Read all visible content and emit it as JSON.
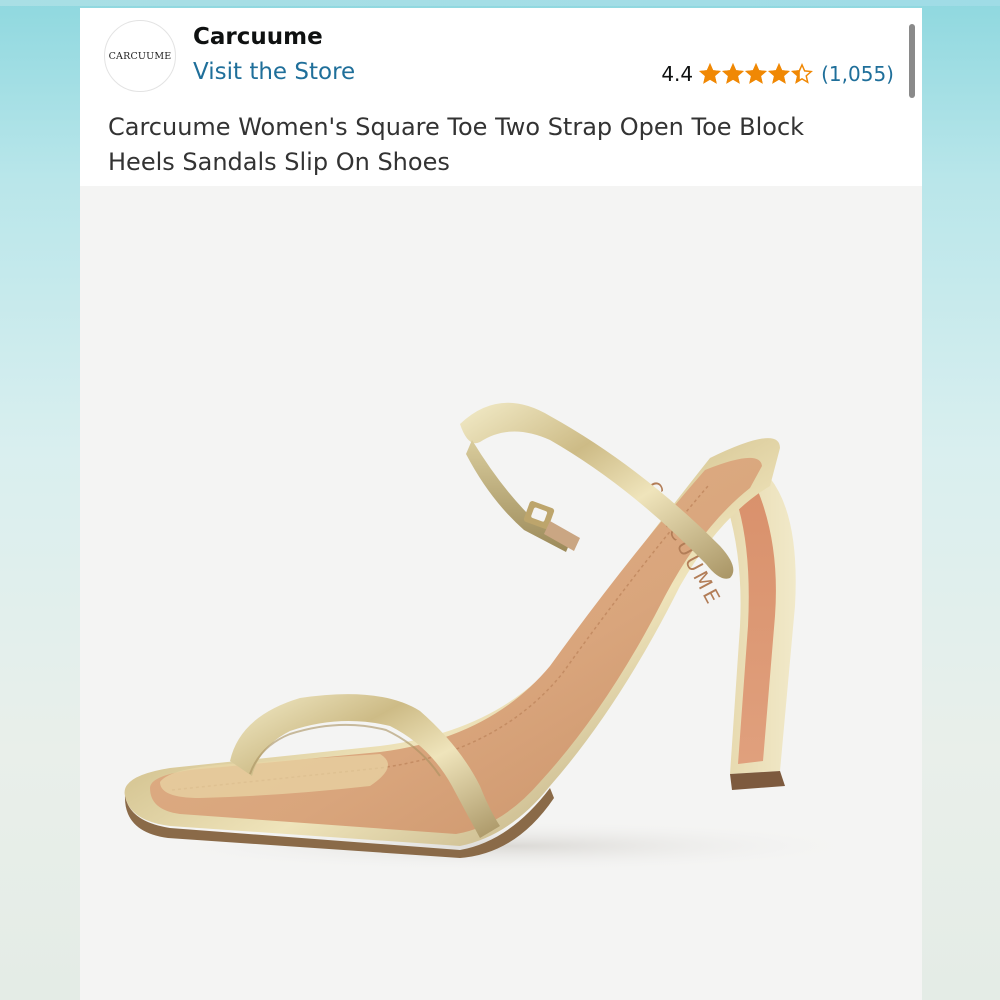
{
  "brand": {
    "logo_text": "CARCUUME",
    "name": "Carcuume",
    "store_link": "Visit the Store"
  },
  "rating": {
    "value": "4.4",
    "stars": 4.4,
    "count": "(1,055)",
    "star_color": "#f08804"
  },
  "product": {
    "title": "Carcuume Women's Square Toe Two Strap Open Toe Block Heels Sandals Slip On Shoes",
    "image_icon": "sandal-photo",
    "insole_brand_text": "CARCUUME"
  },
  "colors": {
    "link": "#1f6f9a",
    "background_gradient_top": "#8fd8df",
    "photo_bg": "#f4f4f3"
  }
}
